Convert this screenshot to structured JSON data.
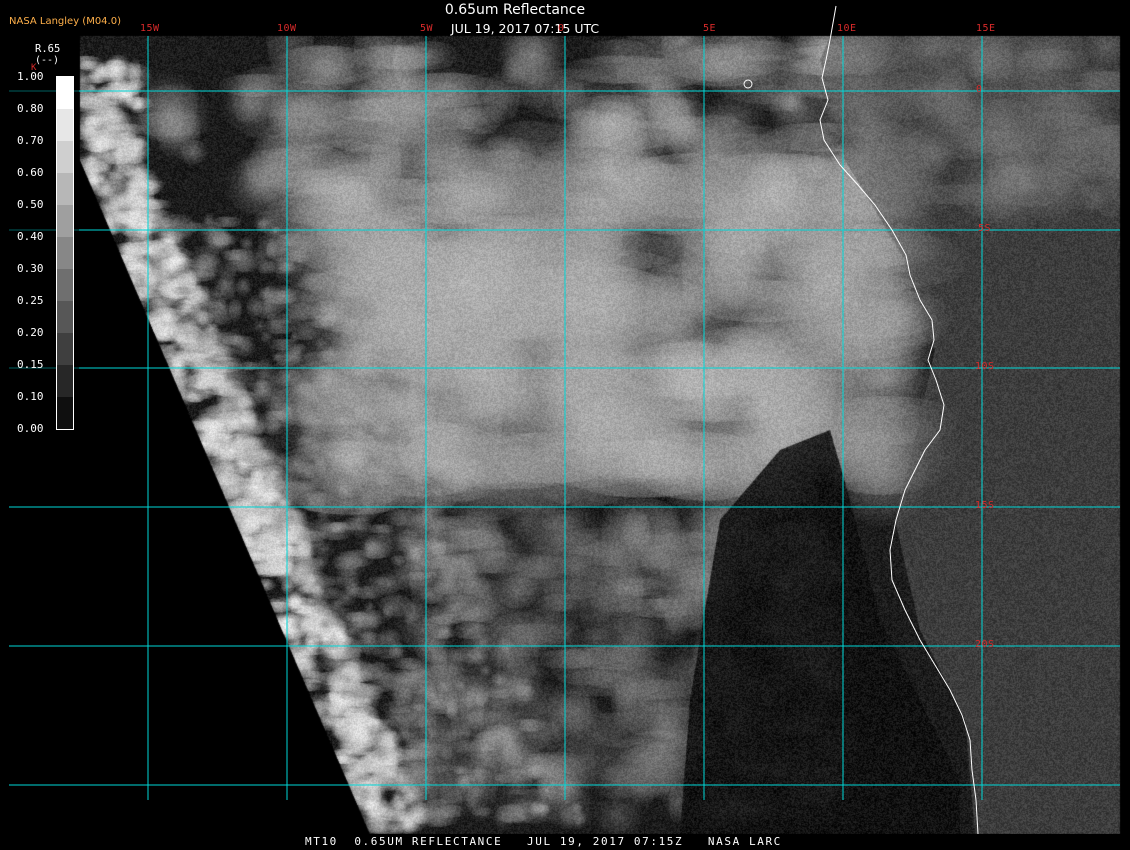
{
  "header": {
    "badge": "NASA Langley (M04.0)",
    "product_title": "0.65um Reflectance",
    "timestamp": "JUL 19, 2017 07:15 UTC"
  },
  "colors": {
    "graticule": "#00d8d8",
    "graticule_label": "#d82a2a",
    "coastline": "#ffffff",
    "badge": "#ffb04a",
    "background": "#000000"
  },
  "map": {
    "longitude_labels": [
      "15W",
      "10W",
      "5W",
      "0",
      "5E",
      "10E",
      "15E"
    ],
    "latitude_labels": [
      "0",
      "5S",
      "10S",
      "15S",
      "20S"
    ]
  },
  "colorbar": {
    "title": "R.65",
    "unit": "(--)",
    "marker": "K",
    "ticks": [
      "1.00",
      "0.80",
      "0.70",
      "0.60",
      "0.50",
      "0.40",
      "0.30",
      "0.25",
      "0.20",
      "0.15",
      "0.10",
      "0.00"
    ]
  },
  "footer": {
    "text": "MT10  0.65UM REFLECTANCE   JUL 19, 2017 07:15Z   NASA LARC"
  }
}
